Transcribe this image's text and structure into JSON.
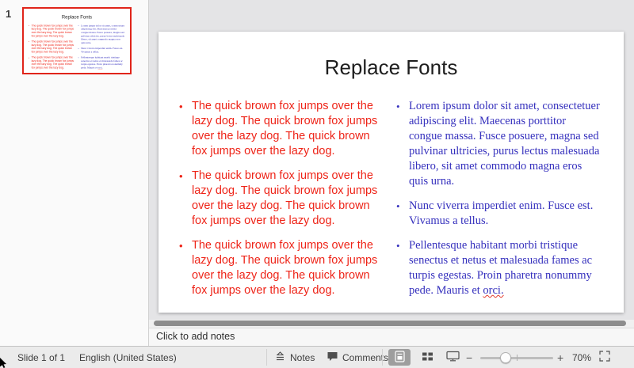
{
  "thumbnail_panel": {
    "slide_number": "1"
  },
  "slide": {
    "title": "Replace Fonts",
    "bullet_char": "•",
    "left_column": {
      "text_color": "#ee2418",
      "bullets": [
        "The quick brown fox jumps over the lazy dog. The quick brown fox jumps over the lazy dog. The quick brown fox jumps over the lazy dog.",
        "The quick brown fox jumps over the lazy dog. The quick brown fox jumps over the lazy dog. The quick brown fox jumps over the lazy dog.",
        "The quick brown fox jumps over the lazy dog. The quick brown fox jumps over the lazy dog. The quick brown fox jumps over the lazy dog."
      ]
    },
    "right_column": {
      "text_color": "#3530bd",
      "bullets": [
        {
          "text": "Lorem ipsum dolor sit amet, consectetuer adipiscing elit. Maecenas porttitor congue massa. Fusce posuere, magna sed pulvinar ultricies, purus lectus malesuada libero, sit amet commodo magna eros quis urna."
        },
        {
          "text": "Nunc viverra imperdiet enim. Fusce est. Vivamus a tellus."
        },
        {
          "text": "Pellentesque habitant morbi tristique senectus et netus et malesuada fames ac turpis egestas. Proin pharetra nonummy pede. Mauris et",
          "misspelled_word": "orci."
        }
      ]
    }
  },
  "notes": {
    "placeholder": "Click to add notes"
  },
  "status_bar": {
    "slide_counter": "Slide 1 of 1",
    "language": "English (United States)",
    "notes_label": "Notes",
    "comments_label": "Comments",
    "zoom_out": "−",
    "zoom_in": "+",
    "zoom_level": "70%",
    "icons": [
      "notes-icon",
      "comments-icon",
      "normal-view-icon",
      "slide-sorter-icon",
      "slideshow-icon",
      "zoom-slider",
      "fit-to-window-icon"
    ]
  },
  "colors": {
    "thumbnail_selection_border": "#e0241a",
    "canvas_background": "#e4e4e6"
  }
}
